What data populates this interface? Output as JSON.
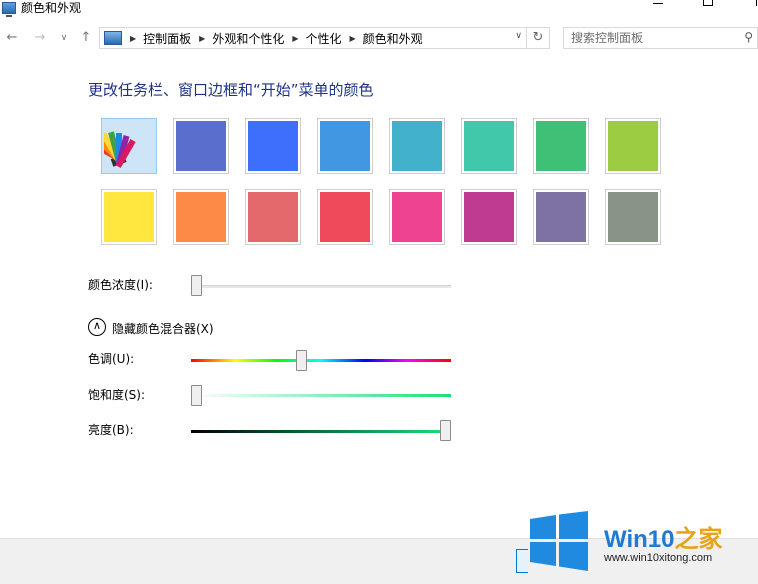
{
  "window": {
    "title": "颜色和外观",
    "icon": "control-panel-monitor-icon"
  },
  "navigation": {
    "breadcrumbs": [
      "控制面板",
      "外观和个性化",
      "个性化",
      "颜色和外观"
    ],
    "search_placeholder": "搜索控制面板"
  },
  "main": {
    "heading": "更改任务栏、窗口边框和“开始”菜单的颜色",
    "swatches_row1": [
      {
        "name": "automatic",
        "color": "#cde5f7"
      },
      {
        "name": "slate-blue",
        "color": "#5a6fcd"
      },
      {
        "name": "blue",
        "color": "#3e6efc"
      },
      {
        "name": "sky-blue",
        "color": "#4197e1"
      },
      {
        "name": "teal",
        "color": "#42b1ca"
      },
      {
        "name": "aqua",
        "color": "#41c8aa"
      },
      {
        "name": "green",
        "color": "#3ec077"
      },
      {
        "name": "lime",
        "color": "#9bcc42"
      }
    ],
    "swatches_row2": [
      {
        "name": "yellow",
        "color": "#ffe740"
      },
      {
        "name": "orange",
        "color": "#fd8b47"
      },
      {
        "name": "salmon",
        "color": "#e3696c"
      },
      {
        "name": "red",
        "color": "#ee4a5b"
      },
      {
        "name": "pink",
        "color": "#ee4390"
      },
      {
        "name": "magenta",
        "color": "#bd3c91"
      },
      {
        "name": "purple-gray",
        "color": "#7e72a5"
      },
      {
        "name": "gray",
        "color": "#899486"
      }
    ],
    "intensity": {
      "label": "颜色浓度(I):",
      "value": 0.0
    },
    "mixer_toggle": {
      "label": "隐藏颜色混合器(X)"
    },
    "hue": {
      "label": "色调(U):",
      "value": 0.42
    },
    "saturation": {
      "label": "饱和度(S):",
      "value": 0.0
    },
    "brightness": {
      "label": "亮度(B):",
      "value": 1.0
    }
  },
  "watermark": {
    "brand_part1": "Win10",
    "brand_part2": "之家",
    "url": "www.win10xitong.com"
  }
}
